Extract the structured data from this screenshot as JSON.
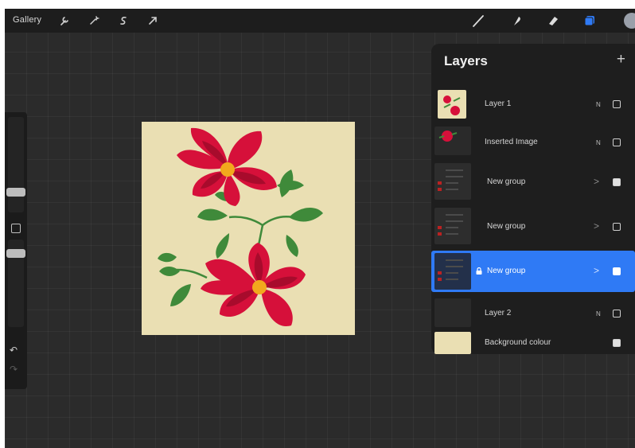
{
  "topbar": {
    "gallery_label": "Gallery",
    "left_tools": [
      "wrench-icon",
      "magic-wand-icon",
      "selection-s-icon",
      "move-arrow-icon"
    ],
    "right_tools": [
      "brush-icon",
      "smudge-icon",
      "eraser-icon",
      "layers-icon",
      "color-circle-icon"
    ],
    "layers_icon_color": "#2f7af5"
  },
  "sidebar": {
    "brush_size_level": 0.5,
    "opacity_level": 0.5,
    "undo_label": "↶",
    "redo_label": "↷"
  },
  "canvas": {
    "background_color": "#eadfb3",
    "flower_color": "#d6103a",
    "leaf_color": "#3f8a3a"
  },
  "layers_panel": {
    "title": "Layers",
    "add_label": "+",
    "layers": [
      {
        "name": "Layer 1",
        "blend": "N",
        "visible": false,
        "type": "layer"
      },
      {
        "name": "Inserted Image",
        "blend": "N",
        "visible": false,
        "type": "layer"
      },
      {
        "name": "New group",
        "chevron": ">",
        "visible": true,
        "type": "group"
      },
      {
        "name": "New group",
        "chevron": ">",
        "visible": false,
        "type": "group"
      },
      {
        "name": "New group",
        "chevron": ">",
        "visible": true,
        "type": "group",
        "selected": true,
        "locked": true
      },
      {
        "name": "Layer 2",
        "blend": "N",
        "visible": false,
        "type": "layer"
      },
      {
        "name": "Background colour",
        "visible": true,
        "type": "background"
      }
    ]
  }
}
